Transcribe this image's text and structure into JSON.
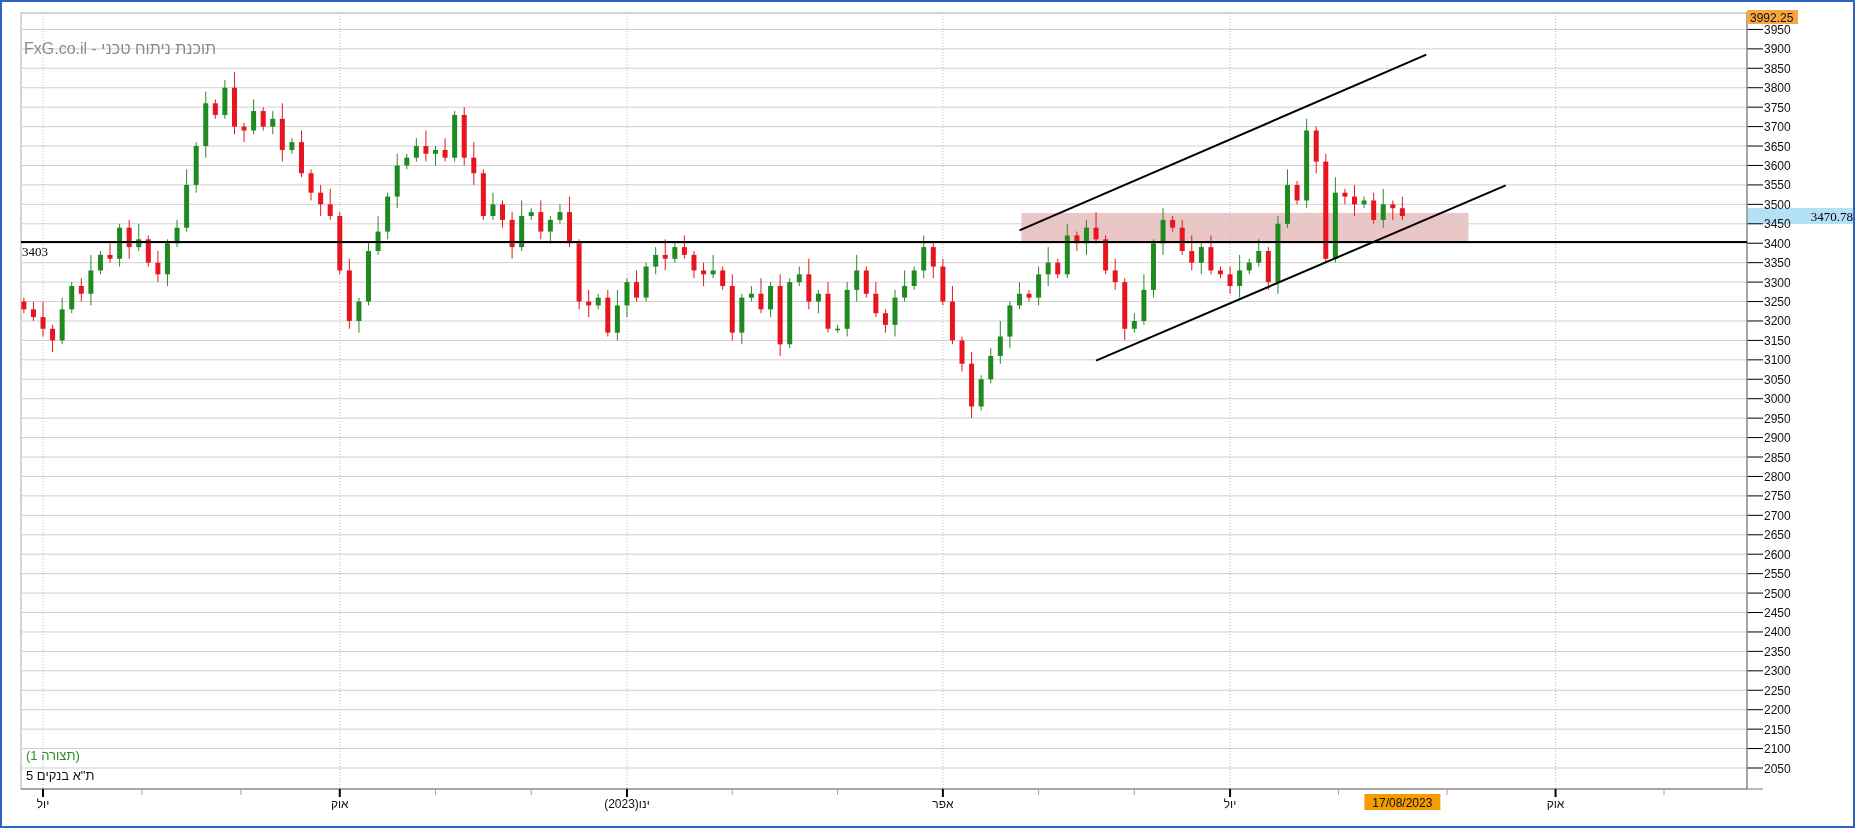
{
  "chart": {
    "title": "תוכנת ניתוח טכני - FxG.co.il",
    "layout_label": "(תצורה 1)",
    "top_value": "3992.25",
    "current_price": "3470.78",
    "cursor_date": "17/08/2023",
    "support_label": "3403",
    "chart_data": {
      "type": "candlestick",
      "grid": true,
      "ylim": [
        1996,
        3992.25
      ],
      "yticks": [
        2050,
        2100,
        2150,
        2200,
        2250,
        2300,
        2350,
        2400,
        2450,
        2500,
        2550,
        2600,
        2650,
        2700,
        2750,
        2800,
        2850,
        2900,
        2950,
        3000,
        3050,
        3100,
        3150,
        3200,
        3250,
        3300,
        3350,
        3400,
        3450,
        3500,
        3550,
        3600,
        3650,
        3700,
        3750,
        3800,
        3850,
        3900,
        3950
      ],
      "categories": [
        null,
        null,
        "יול",
        null,
        null,
        null,
        null,
        null,
        null,
        null,
        null,
        null,
        null,
        null,
        null,
        null,
        null,
        null,
        null,
        null,
        null,
        null,
        null,
        null,
        null,
        null,
        null,
        null,
        null,
        null,
        null,
        null,
        null,
        "אוק",
        null,
        null,
        null,
        null,
        null,
        null,
        null,
        null,
        null,
        null,
        null,
        null,
        null,
        null,
        null,
        null,
        null,
        null,
        null,
        null,
        null,
        null,
        null,
        null,
        null,
        null,
        null,
        null,
        null,
        "ינו(2023)",
        null,
        null,
        null,
        null,
        null,
        null,
        null,
        null,
        null,
        null,
        null,
        null,
        null,
        null,
        null,
        null,
        null,
        null,
        null,
        null,
        null,
        null,
        null,
        null,
        null,
        null,
        null,
        null,
        null,
        null,
        null,
        null,
        "אפר",
        null,
        null,
        null,
        null,
        null,
        null,
        null,
        null,
        null,
        null,
        null,
        null,
        null,
        null,
        null,
        null,
        null,
        null,
        null,
        null,
        null,
        null,
        null,
        null,
        null,
        null,
        null,
        null,
        null,
        "יול",
        null,
        null,
        null,
        null,
        null,
        null,
        null,
        null,
        null,
        null,
        null,
        null,
        null,
        null,
        null,
        null,
        null,
        null,
        null,
        null,
        null,
        null,
        null,
        null,
        null,
        null,
        null,
        null,
        null,
        null,
        null,
        null,
        null,
        "אוק",
        null,
        null,
        null,
        null,
        null,
        null,
        null,
        null,
        null,
        null,
        null,
        null,
        null,
        null,
        null,
        null,
        null,
        null,
        null,
        null
      ],
      "series": [
        {
          "name": "ת\"א בנקים 5",
          "ohlc": [
            [
              3250,
              3260,
              3220,
              3230
            ],
            [
              3230,
              3250,
              3200,
              3210
            ],
            [
              3210,
              3250,
              3160,
              3180
            ],
            [
              3180,
              3190,
              3120,
              3150
            ],
            [
              3150,
              3260,
              3140,
              3230
            ],
            [
              3230,
              3300,
              3220,
              3290
            ],
            [
              3290,
              3310,
              3250,
              3270
            ],
            [
              3270,
              3370,
              3240,
              3330
            ],
            [
              3330,
              3380,
              3320,
              3370
            ],
            [
              3370,
              3400,
              3350,
              3360
            ],
            [
              3360,
              3450,
              3340,
              3440
            ],
            [
              3440,
              3460,
              3360,
              3390
            ],
            [
              3390,
              3450,
              3380,
              3410
            ],
            [
              3410,
              3420,
              3340,
              3350
            ],
            [
              3350,
              3380,
              3300,
              3320
            ],
            [
              3320,
              3410,
              3290,
              3400
            ],
            [
              3400,
              3460,
              3390,
              3440
            ],
            [
              3440,
              3590,
              3430,
              3550
            ],
            [
              3550,
              3660,
              3530,
              3650
            ],
            [
              3650,
              3790,
              3620,
              3760
            ],
            [
              3760,
              3770,
              3720,
              3730
            ],
            [
              3730,
              3820,
              3720,
              3800
            ],
            [
              3800,
              3840,
              3680,
              3700
            ],
            [
              3700,
              3710,
              3660,
              3690
            ],
            [
              3690,
              3770,
              3680,
              3740
            ],
            [
              3740,
              3750,
              3690,
              3700
            ],
            [
              3700,
              3740,
              3680,
              3720
            ],
            [
              3720,
              3760,
              3610,
              3640
            ],
            [
              3640,
              3670,
              3630,
              3660
            ],
            [
              3660,
              3690,
              3570,
              3580
            ],
            [
              3580,
              3590,
              3510,
              3530
            ],
            [
              3530,
              3550,
              3470,
              3500
            ],
            [
              3500,
              3540,
              3460,
              3470
            ],
            [
              3470,
              3480,
              3320,
              3330
            ],
            [
              3330,
              3360,
              3180,
              3200
            ],
            [
              3200,
              3260,
              3170,
              3250
            ],
            [
              3250,
              3400,
              3240,
              3380
            ],
            [
              3380,
              3470,
              3370,
              3430
            ],
            [
              3430,
              3530,
              3410,
              3520
            ],
            [
              3520,
              3630,
              3490,
              3600
            ],
            [
              3600,
              3630,
              3590,
              3620
            ],
            [
              3620,
              3670,
              3610,
              3650
            ],
            [
              3650,
              3690,
              3610,
              3630
            ],
            [
              3630,
              3650,
              3600,
              3640
            ],
            [
              3640,
              3670,
              3610,
              3620
            ],
            [
              3620,
              3740,
              3610,
              3730
            ],
            [
              3730,
              3750,
              3600,
              3620
            ],
            [
              3620,
              3660,
              3550,
              3580
            ],
            [
              3580,
              3590,
              3460,
              3470
            ],
            [
              3470,
              3530,
              3460,
              3500
            ],
            [
              3500,
              3510,
              3440,
              3460
            ],
            [
              3460,
              3480,
              3360,
              3390
            ],
            [
              3390,
              3510,
              3380,
              3470
            ],
            [
              3470,
              3490,
              3460,
              3480
            ],
            [
              3480,
              3510,
              3410,
              3430
            ],
            [
              3430,
              3470,
              3400,
              3460
            ],
            [
              3460,
              3500,
              3450,
              3480
            ],
            [
              3480,
              3520,
              3390,
              3400
            ],
            [
              3400,
              3410,
              3230,
              3250
            ],
            [
              3250,
              3280,
              3210,
              3240
            ],
            [
              3240,
              3270,
              3230,
              3260
            ],
            [
              3260,
              3280,
              3160,
              3170
            ],
            [
              3170,
              3280,
              3150,
              3240
            ],
            [
              3240,
              3310,
              3210,
              3300
            ],
            [
              3300,
              3330,
              3250,
              3260
            ],
            [
              3260,
              3350,
              3250,
              3340
            ],
            [
              3340,
              3390,
              3320,
              3370
            ],
            [
              3370,
              3410,
              3330,
              3360
            ],
            [
              3360,
              3400,
              3350,
              3390
            ],
            [
              3390,
              3420,
              3360,
              3370
            ],
            [
              3370,
              3380,
              3310,
              3330
            ],
            [
              3330,
              3350,
              3290,
              3320
            ],
            [
              3320,
              3370,
              3310,
              3330
            ],
            [
              3330,
              3340,
              3280,
              3290
            ],
            [
              3290,
              3320,
              3150,
              3170
            ],
            [
              3170,
              3270,
              3140,
              3260
            ],
            [
              3260,
              3290,
              3250,
              3270
            ],
            [
              3270,
              3310,
              3220,
              3230
            ],
            [
              3230,
              3300,
              3210,
              3290
            ],
            [
              3290,
              3320,
              3110,
              3140
            ],
            [
              3140,
              3310,
              3130,
              3300
            ],
            [
              3300,
              3340,
              3290,
              3320
            ],
            [
              3320,
              3360,
              3230,
              3250
            ],
            [
              3250,
              3280,
              3220,
              3270
            ],
            [
              3270,
              3300,
              3170,
              3180
            ],
            [
              3180,
              3190,
              3170,
              3180
            ],
            [
              3180,
              3300,
              3160,
              3280
            ],
            [
              3280,
              3370,
              3250,
              3330
            ],
            [
              3330,
              3340,
              3260,
              3270
            ],
            [
              3270,
              3300,
              3210,
              3220
            ],
            [
              3220,
              3230,
              3170,
              3190
            ],
            [
              3190,
              3280,
              3160,
              3260
            ],
            [
              3260,
              3330,
              3250,
              3290
            ],
            [
              3290,
              3340,
              3280,
              3330
            ],
            [
              3330,
              3420,
              3310,
              3390
            ],
            [
              3390,
              3400,
              3310,
              3340
            ],
            [
              3340,
              3360,
              3240,
              3250
            ],
            [
              3250,
              3290,
              3140,
              3150
            ],
            [
              3150,
              3160,
              3070,
              3090
            ],
            [
              3090,
              3120,
              2950,
              2980
            ],
            [
              2980,
              3060,
              2970,
              3050
            ],
            [
              3050,
              3130,
              3040,
              3110
            ],
            [
              3110,
              3200,
              3090,
              3160
            ],
            [
              3160,
              3250,
              3130,
              3240
            ],
            [
              3240,
              3300,
              3230,
              3270
            ],
            [
              3270,
              3280,
              3250,
              3260
            ],
            [
              3260,
              3340,
              3240,
              3320
            ],
            [
              3320,
              3390,
              3290,
              3350
            ],
            [
              3350,
              3360,
              3310,
              3320
            ],
            [
              3320,
              3450,
              3310,
              3420
            ],
            [
              3420,
              3430,
              3380,
              3400
            ],
            [
              3400,
              3460,
              3370,
              3440
            ],
            [
              3440,
              3480,
              3400,
              3410
            ],
            [
              3410,
              3420,
              3320,
              3330
            ],
            [
              3330,
              3360,
              3280,
              3300
            ],
            [
              3300,
              3310,
              3150,
              3180
            ],
            [
              3180,
              3220,
              3170,
              3200
            ],
            [
              3200,
              3320,
              3190,
              3280
            ],
            [
              3280,
              3410,
              3260,
              3400
            ],
            [
              3400,
              3490,
              3370,
              3460
            ],
            [
              3460,
              3470,
              3430,
              3440
            ],
            [
              3440,
              3460,
              3370,
              3380
            ],
            [
              3380,
              3420,
              3330,
              3350
            ],
            [
              3350,
              3400,
              3320,
              3390
            ],
            [
              3390,
              3420,
              3320,
              3330
            ],
            [
              3330,
              3340,
              3310,
              3320
            ],
            [
              3320,
              3340,
              3270,
              3290
            ],
            [
              3290,
              3370,
              3260,
              3330
            ],
            [
              3330,
              3360,
              3320,
              3350
            ],
            [
              3350,
              3410,
              3340,
              3380
            ],
            [
              3380,
              3390,
              3280,
              3300
            ],
            [
              3300,
              3470,
              3270,
              3450
            ],
            [
              3450,
              3590,
              3440,
              3550
            ],
            [
              3550,
              3560,
              3500,
              3510
            ],
            [
              3510,
              3720,
              3490,
              3690
            ],
            [
              3690,
              3700,
              3580,
              3610
            ],
            [
              3610,
              3630,
              3350,
              3360
            ],
            [
              3360,
              3570,
              3350,
              3530
            ],
            [
              3530,
              3540,
              3500,
              3520
            ],
            [
              3520,
              3550,
              3470,
              3500
            ],
            [
              3500,
              3520,
              3490,
              3510
            ],
            [
              3510,
              3530,
              3450,
              3460
            ],
            [
              3460,
              3540,
              3440,
              3500
            ],
            [
              3500,
              3510,
              3460,
              3490
            ],
            [
              3490,
              3520,
              3460,
              3470
            ],
            null,
            null,
            null,
            null,
            null,
            null,
            null,
            null,
            null,
            null,
            null,
            null,
            null,
            null,
            null,
            null,
            null,
            null,
            null,
            null,
            null,
            null,
            null,
            null,
            null,
            null,
            null,
            null,
            null,
            null,
            null,
            null,
            null,
            null,
            null,
            null
          ]
        }
      ]
    }
  }
}
